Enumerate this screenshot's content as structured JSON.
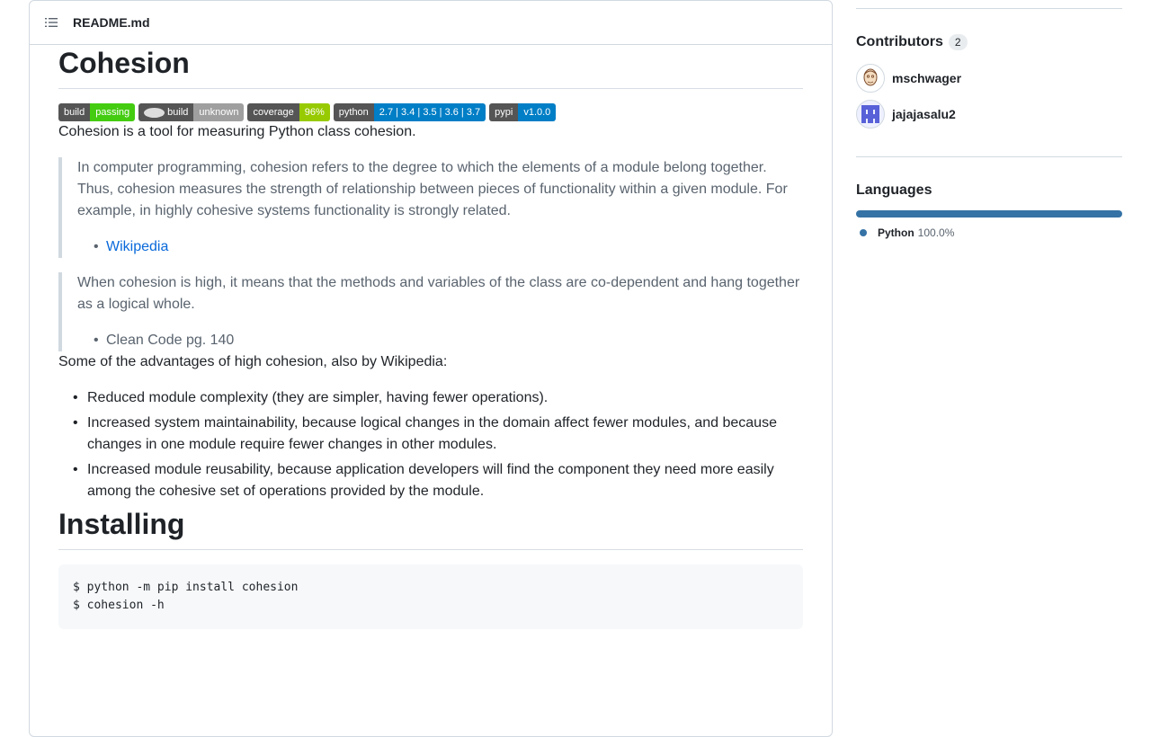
{
  "readme": {
    "filename": "README.md",
    "title": "Cohesion",
    "badges": [
      {
        "label": "build",
        "value": "passing",
        "color": "#4c1"
      },
      {
        "label": "build",
        "value": "unknown",
        "color": "#9f9f9f",
        "icon": "github-icon"
      },
      {
        "label": "coverage",
        "value": "96%",
        "color": "#97ca00"
      },
      {
        "label": "python",
        "value": "2.7 | 3.4 | 3.5 | 3.6 | 3.7",
        "color": "#007ec6"
      },
      {
        "label": "pypi",
        "value": "v1.0.0",
        "color": "#007ec6"
      }
    ],
    "intro": "Cohesion is a tool for measuring Python class cohesion.",
    "quote1": {
      "text": "In computer programming, cohesion refers to the degree to which the elements of a module belong together. Thus, cohesion measures the strength of relationship between pieces of functionality within a given module. For example, in highly cohesive systems functionality is strongly related.",
      "source": "Wikipedia"
    },
    "quote2": {
      "text": "When cohesion is high, it means that the methods and variables of the class are co-dependent and hang together as a logical whole.",
      "source": "Clean Code pg. 140"
    },
    "advantages_intro": "Some of the advantages of high cohesion, also by Wikipedia:",
    "advantages": [
      "Reduced module complexity (they are simpler, having fewer operations).",
      "Increased system maintainability, because logical changes in the domain affect fewer modules, and because changes in one module require fewer changes in other modules.",
      "Increased module reusability, because application developers will find the component they need more easily among the cohesive set of operations provided by the module."
    ],
    "installing_heading": "Installing",
    "install_code": "$ python -m pip install cohesion\n$ cohesion -h"
  },
  "sidebar": {
    "contributors_heading": "Contributors",
    "contributors_count": "2",
    "contributors": [
      {
        "name": "mschwager"
      },
      {
        "name": "jajajasalu2"
      }
    ],
    "languages_heading": "Languages",
    "languages": [
      {
        "name": "Python",
        "percent": "100.0%",
        "fraction": 1.0,
        "color": "#3572a5"
      }
    ]
  }
}
